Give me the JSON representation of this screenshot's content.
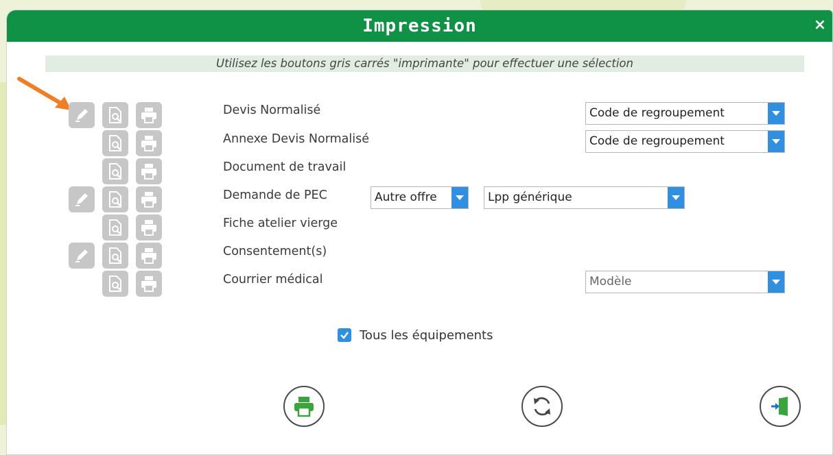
{
  "dialog": {
    "title": "Impression",
    "close_label": "×",
    "instruction": "Utilisez les boutons gris carrés \"imprimante\" pour effectuer une sélection"
  },
  "rows": [
    {
      "label": "Devis Normalisé",
      "select": "Code de regroupement"
    },
    {
      "label": "Annexe Devis Normalisé",
      "select": "Code de regroupement"
    },
    {
      "label": "Document de travail"
    },
    {
      "label": "Demande de PEC",
      "select_a": "Autre offre",
      "select_b": "Lpp générique"
    },
    {
      "label": "Fiche atelier vierge"
    },
    {
      "label": "Consentement(s)"
    },
    {
      "label": "Courrier médical",
      "select_placeholder": "Modèle"
    }
  ],
  "options": {
    "all_equipment_label": "Tous les équipements",
    "all_equipment_checked": true
  },
  "colors": {
    "titlebar": "#0f9146",
    "accent": "#2f8fe0",
    "arrow": "#f07f24",
    "icon_button": "#c7c7c7"
  }
}
